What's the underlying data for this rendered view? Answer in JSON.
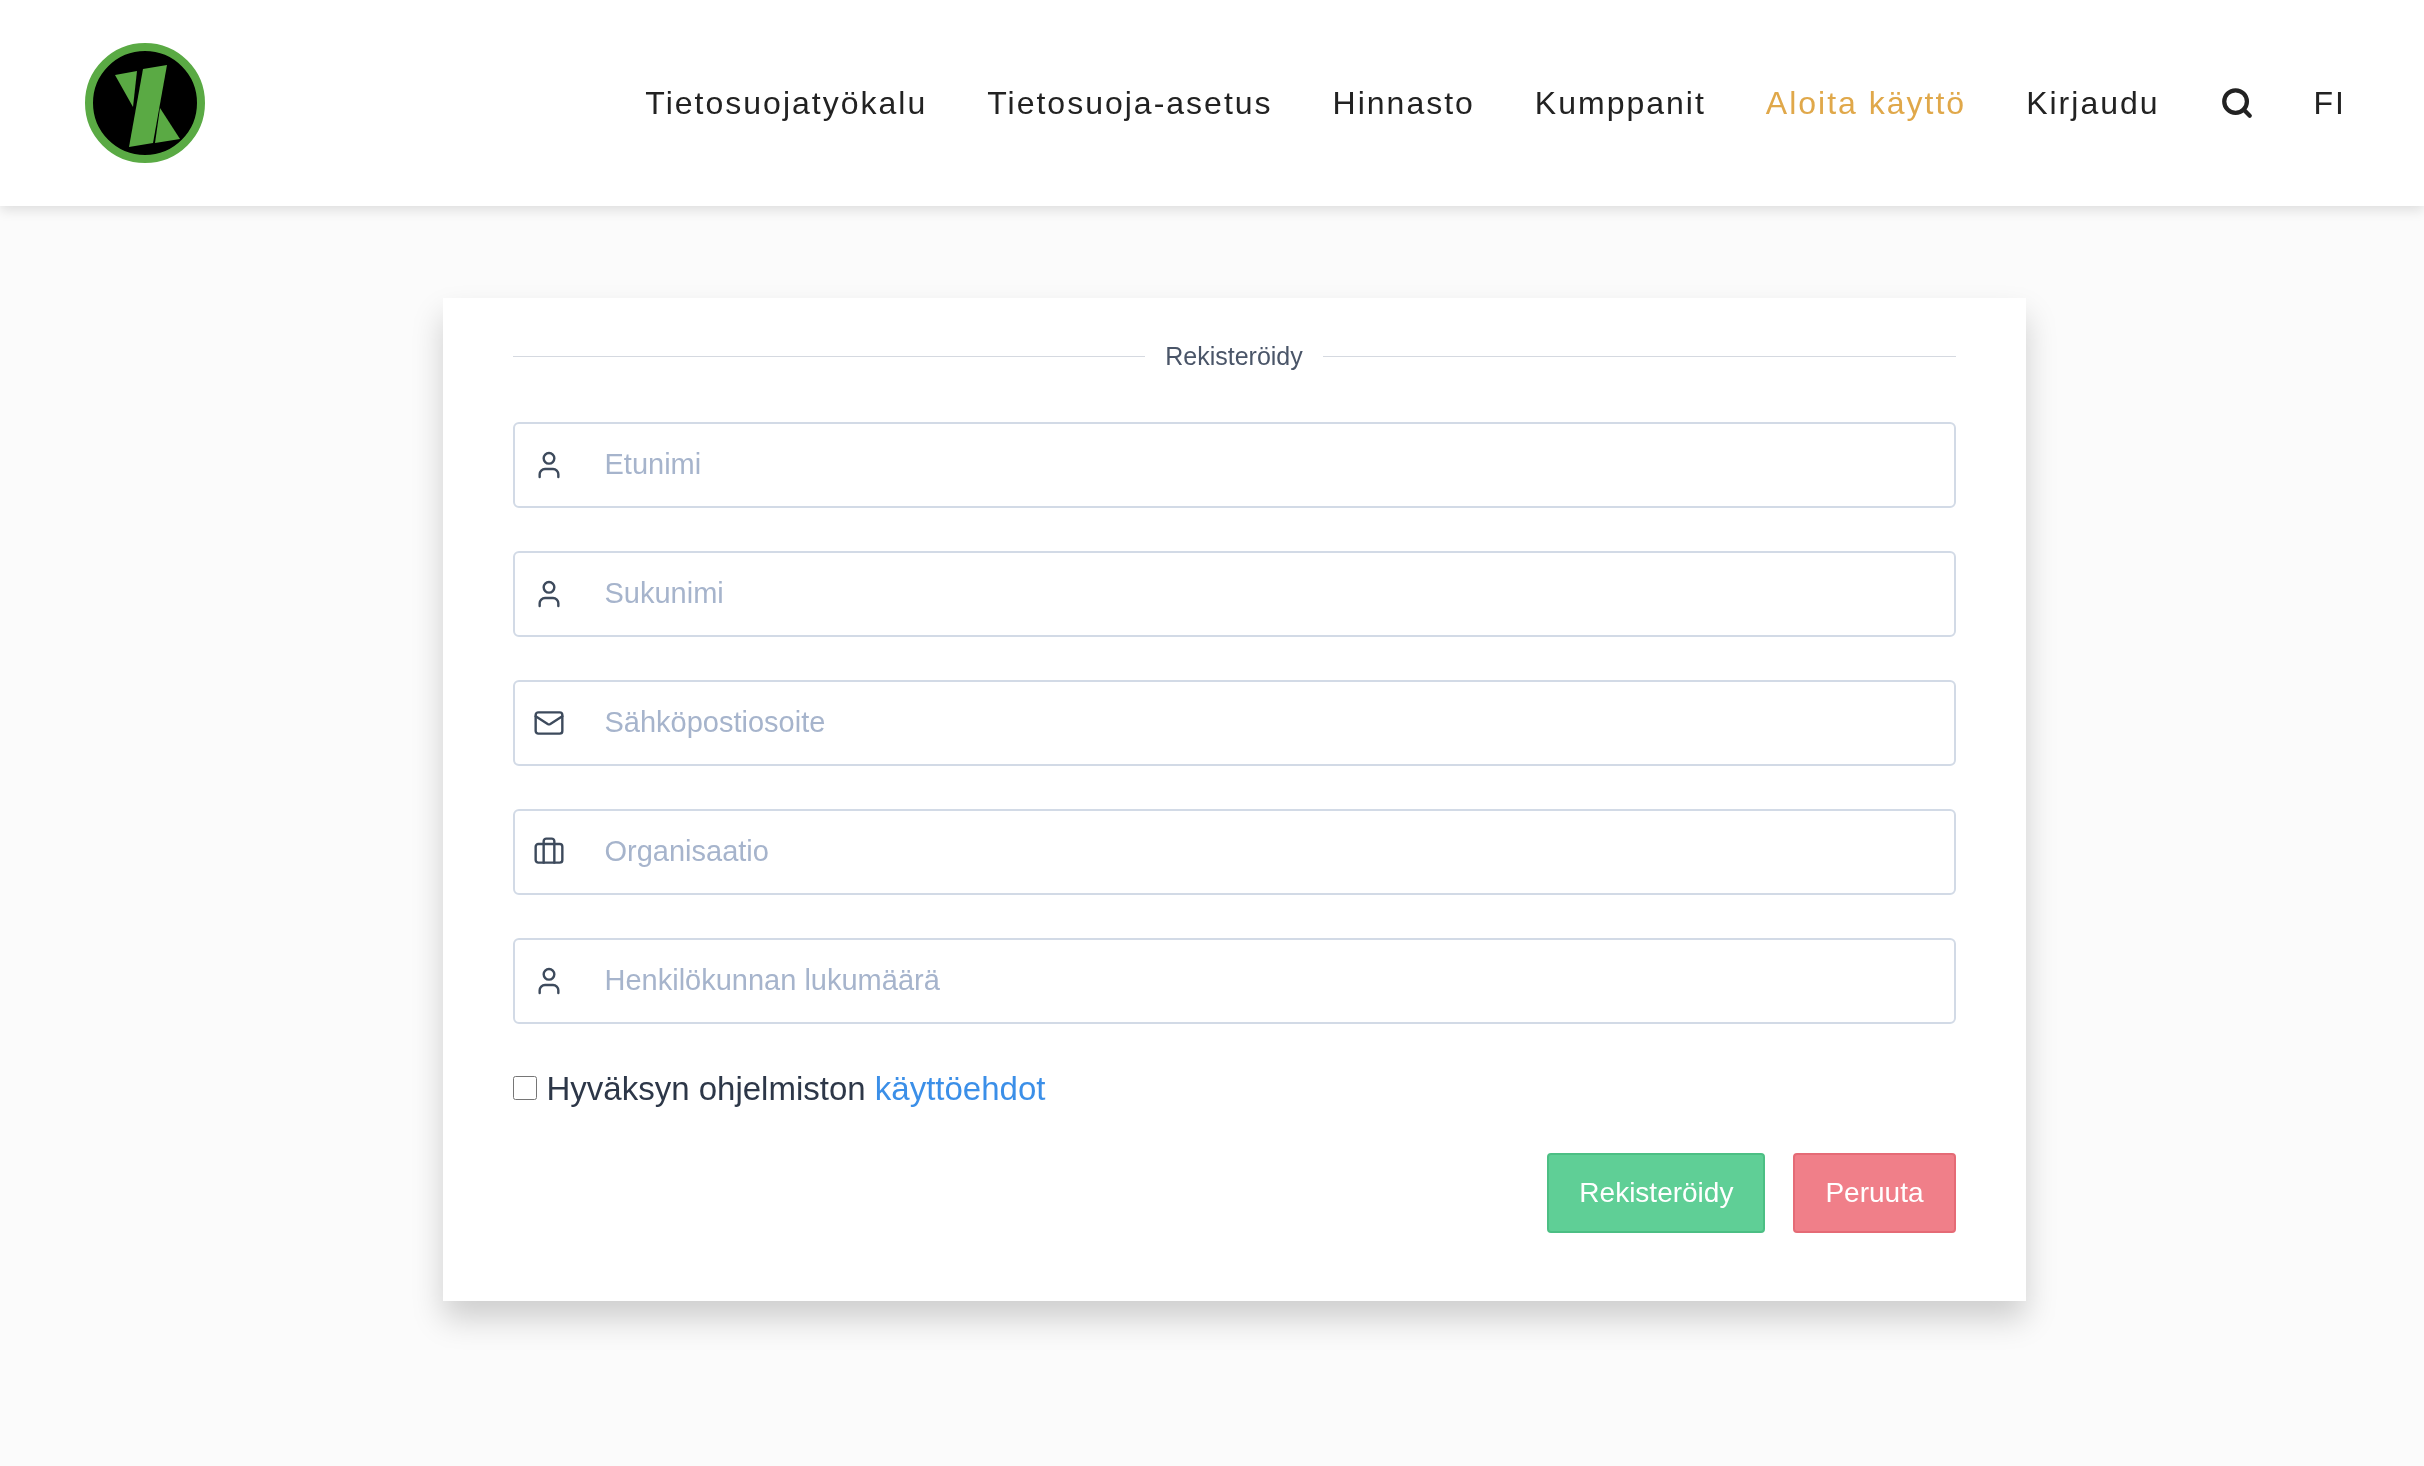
{
  "header": {
    "nav": [
      {
        "label": "Tietosuojatyökalu",
        "selected": false
      },
      {
        "label": "Tietosuoja-asetus",
        "selected": false
      },
      {
        "label": "Hinnasto",
        "selected": false
      },
      {
        "label": "Kumppanit",
        "selected": false
      },
      {
        "label": "Aloita käyttö",
        "selected": true
      },
      {
        "label": "Kirjaudu",
        "selected": false
      }
    ],
    "language": "FI"
  },
  "form": {
    "legend": "Rekisteröidy",
    "fields": [
      {
        "kind": "user",
        "placeholder": "Etunimi"
      },
      {
        "kind": "user",
        "placeholder": "Sukunimi"
      },
      {
        "kind": "mail",
        "placeholder": "Sähköpostiosoite"
      },
      {
        "kind": "briefcase",
        "placeholder": "Organisaatio"
      },
      {
        "kind": "user",
        "placeholder": "Henkilökunnan lukumäärä"
      }
    ],
    "terms": {
      "checked": false,
      "text": "Hyväksyn ohjelmiston",
      "link": "käyttöehdot"
    },
    "buttons": [
      {
        "kind": "primary",
        "label": "Rekisteröidy"
      },
      {
        "kind": "danger",
        "label": "Peruuta"
      }
    ]
  }
}
